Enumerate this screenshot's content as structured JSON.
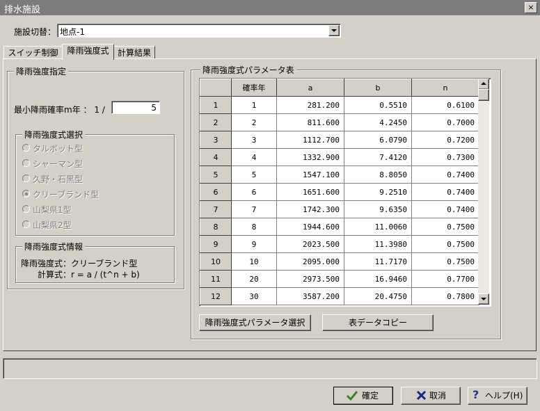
{
  "window": {
    "title": "排水施設",
    "close": "×"
  },
  "facility": {
    "label": "施設切替：",
    "value": "地点-1"
  },
  "tabs": [
    "スイッチ制御",
    "降雨強度式",
    "計算結果"
  ],
  "intensity": {
    "group_title": "降雨強度指定",
    "min_label": "最小降雨確率m年 ： 1 /",
    "min_value": "5",
    "formula_group_title": "降雨強度式選択",
    "formulas": [
      "タルボット型",
      "シャーマン型",
      "久野・石黒型",
      "クリーブランド型",
      "山梨県1型",
      "山梨県2型"
    ],
    "selected_formula": "クリーブランド型",
    "info_title": "降雨強度式情報",
    "info_formula": "降雨強度式：クリーブランド型",
    "info_calc": "計算式：r = a / (t^n + b)"
  },
  "param_table": {
    "title": "降雨強度式パラメータ表",
    "headers": [
      "",
      "確率年",
      "a",
      "b",
      "n"
    ],
    "rows": [
      [
        "1",
        "1",
        "281.200",
        "0.5510",
        "0.6100"
      ],
      [
        "2",
        "2",
        "811.600",
        "4.2450",
        "0.7000"
      ],
      [
        "3",
        "3",
        "1112.700",
        "6.0790",
        "0.7200"
      ],
      [
        "4",
        "4",
        "1332.900",
        "7.4120",
        "0.7300"
      ],
      [
        "5",
        "5",
        "1547.100",
        "8.8050",
        "0.7400"
      ],
      [
        "6",
        "6",
        "1651.600",
        "9.2510",
        "0.7400"
      ],
      [
        "7",
        "7",
        "1742.300",
        "9.6350",
        "0.7400"
      ],
      [
        "8",
        "8",
        "1944.600",
        "11.0060",
        "0.7500"
      ],
      [
        "9",
        "9",
        "2023.500",
        "11.3980",
        "0.7500"
      ],
      [
        "10",
        "10",
        "2095.000",
        "11.7170",
        "0.7500"
      ],
      [
        "11",
        "20",
        "2973.500",
        "16.9460",
        "0.7700"
      ],
      [
        "12",
        "30",
        "3587.200",
        "20.4750",
        "0.7800"
      ]
    ],
    "select_button": "降雨強度式パラメータ選択",
    "copy_button": "表データコピー"
  },
  "footer": {
    "ok": "確定",
    "cancel": "取消",
    "help": "ヘルプ(H)"
  },
  "colors": {
    "titlebar": "#7b7b7b",
    "face": "#d4d0c8",
    "ok_check": "#2e8b1e",
    "cancel_x": "#1a2a8c",
    "help_q": "#1a3a8c"
  }
}
